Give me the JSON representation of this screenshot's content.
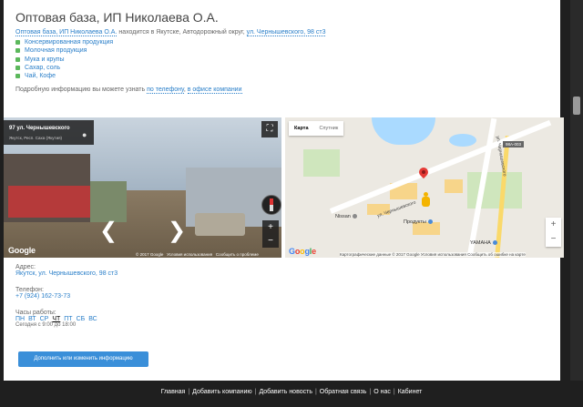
{
  "page": {
    "title": "Оптовая база, ИП Николаева О.А.",
    "intro": {
      "company": "Оптовая база, ИП Николаева О.А.",
      "middle": " находится в Якутске, Автодорожный округ, ",
      "address": "ул. Чернышевского, 98 ст3"
    },
    "categories": [
      "Консервированная продукция",
      "Молочная продукция",
      "Мука и крупы",
      "Сахар, соль",
      "Чай, Кофе"
    ],
    "more": {
      "prefix": "Подробную информацию вы можете узнать ",
      "phone_link": "по телефону",
      "middle": ", ",
      "office_link": "в офисе компании"
    }
  },
  "streetview": {
    "title": "97 ул. Чернышевского",
    "subtitle": "Якутск, Респ. Саха (Якутия)",
    "google": "Google",
    "copyright": "© 2017 Google",
    "terms": "Условия использования",
    "report": "Сообщить о проблеме"
  },
  "map": {
    "tab_map": "Карта",
    "tab_satellite": "Спутник",
    "road_label": "ул. Чернышевского",
    "road_label_2": "ул. Чернышевского",
    "badge": "98А-003",
    "poi_nissan": "Nissan",
    "poi_products": "Продукты",
    "poi_yamaha": "YAMAHA",
    "footer": "Картографические данные © 2017 Google  Условия использования  Сообщить об ошибке на карте",
    "google": "Google",
    "zoom_in": "+",
    "zoom_out": "−"
  },
  "contact": {
    "address_label": "Адрес:",
    "address_value": "Якутск, ул. Чернышевского, 98 ст3",
    "phone_label": "Телефон:",
    "phone_value": "+7 (924) 162-73-73",
    "hours_label": "Часы работы:",
    "days": [
      "ПН",
      "ВТ",
      "СР",
      "ЧТ",
      "ПТ",
      "СБ",
      "ВС"
    ],
    "today": "Сегодня с 9:00 до 18:00"
  },
  "button": {
    "label": "Дополнить или изменить информацию"
  },
  "footer": {
    "links": [
      "Главная",
      "Добавить компанию",
      "Добавить новость",
      "Обратная связь",
      "О нас",
      "Кабинет"
    ]
  }
}
